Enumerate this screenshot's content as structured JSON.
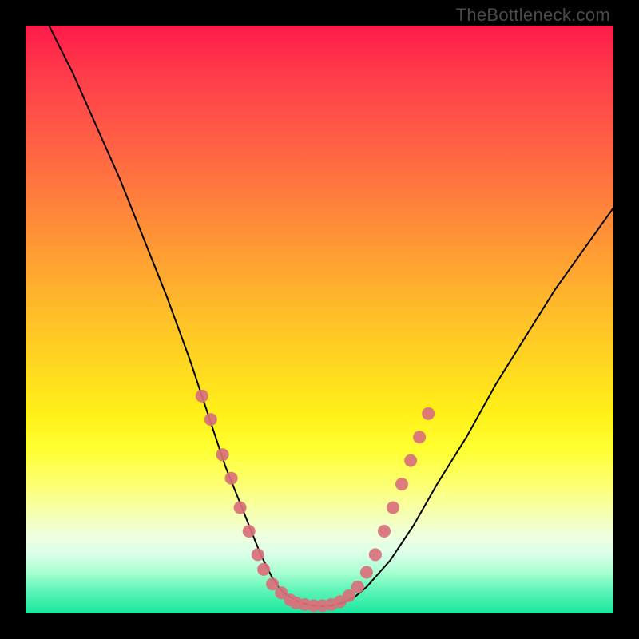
{
  "watermark": "TheBottleneck.com",
  "chart_data": {
    "type": "line",
    "title": "",
    "xlabel": "",
    "ylabel": "",
    "xlim": [
      0,
      100
    ],
    "ylim": [
      0,
      100
    ],
    "series": [
      {
        "name": "curve",
        "x": [
          4,
          8,
          12,
          16,
          20,
          24,
          28,
          30,
          32,
          34,
          36,
          38,
          40,
          41,
          42,
          43,
          44,
          45,
          46,
          47,
          48,
          49,
          50,
          52,
          54,
          56,
          58,
          62,
          66,
          70,
          75,
          80,
          85,
          90,
          95,
          100
        ],
        "y": [
          100,
          92,
          83,
          74,
          64,
          54,
          43,
          37,
          31,
          25,
          20,
          15,
          10,
          8,
          6,
          4.5,
          3.5,
          2.8,
          2.2,
          1.8,
          1.5,
          1.3,
          1.2,
          1.3,
          1.8,
          2.8,
          4.5,
          9,
          15,
          22,
          30,
          39,
          47,
          55,
          62,
          69
        ]
      }
    ],
    "datapoints": [
      {
        "x": 30,
        "y": 37
      },
      {
        "x": 31.5,
        "y": 33
      },
      {
        "x": 33.5,
        "y": 27
      },
      {
        "x": 35,
        "y": 23
      },
      {
        "x": 36.5,
        "y": 18
      },
      {
        "x": 38,
        "y": 14
      },
      {
        "x": 39.5,
        "y": 10
      },
      {
        "x": 40.5,
        "y": 7.5
      },
      {
        "x": 42,
        "y": 5
      },
      {
        "x": 43.5,
        "y": 3.5
      },
      {
        "x": 45,
        "y": 2.3
      },
      {
        "x": 46,
        "y": 1.8
      },
      {
        "x": 47.5,
        "y": 1.5
      },
      {
        "x": 49,
        "y": 1.3
      },
      {
        "x": 50.5,
        "y": 1.3
      },
      {
        "x": 52,
        "y": 1.5
      },
      {
        "x": 53.5,
        "y": 2.0
      },
      {
        "x": 55,
        "y": 3.0
      },
      {
        "x": 56.5,
        "y": 4.5
      },
      {
        "x": 58,
        "y": 7
      },
      {
        "x": 59.5,
        "y": 10
      },
      {
        "x": 61,
        "y": 14
      },
      {
        "x": 62.5,
        "y": 18
      },
      {
        "x": 64,
        "y": 22
      },
      {
        "x": 65.5,
        "y": 26
      },
      {
        "x": 67,
        "y": 30
      },
      {
        "x": 68.5,
        "y": 34
      }
    ],
    "dot_color": "#d97079",
    "curve_color": "#000000"
  }
}
